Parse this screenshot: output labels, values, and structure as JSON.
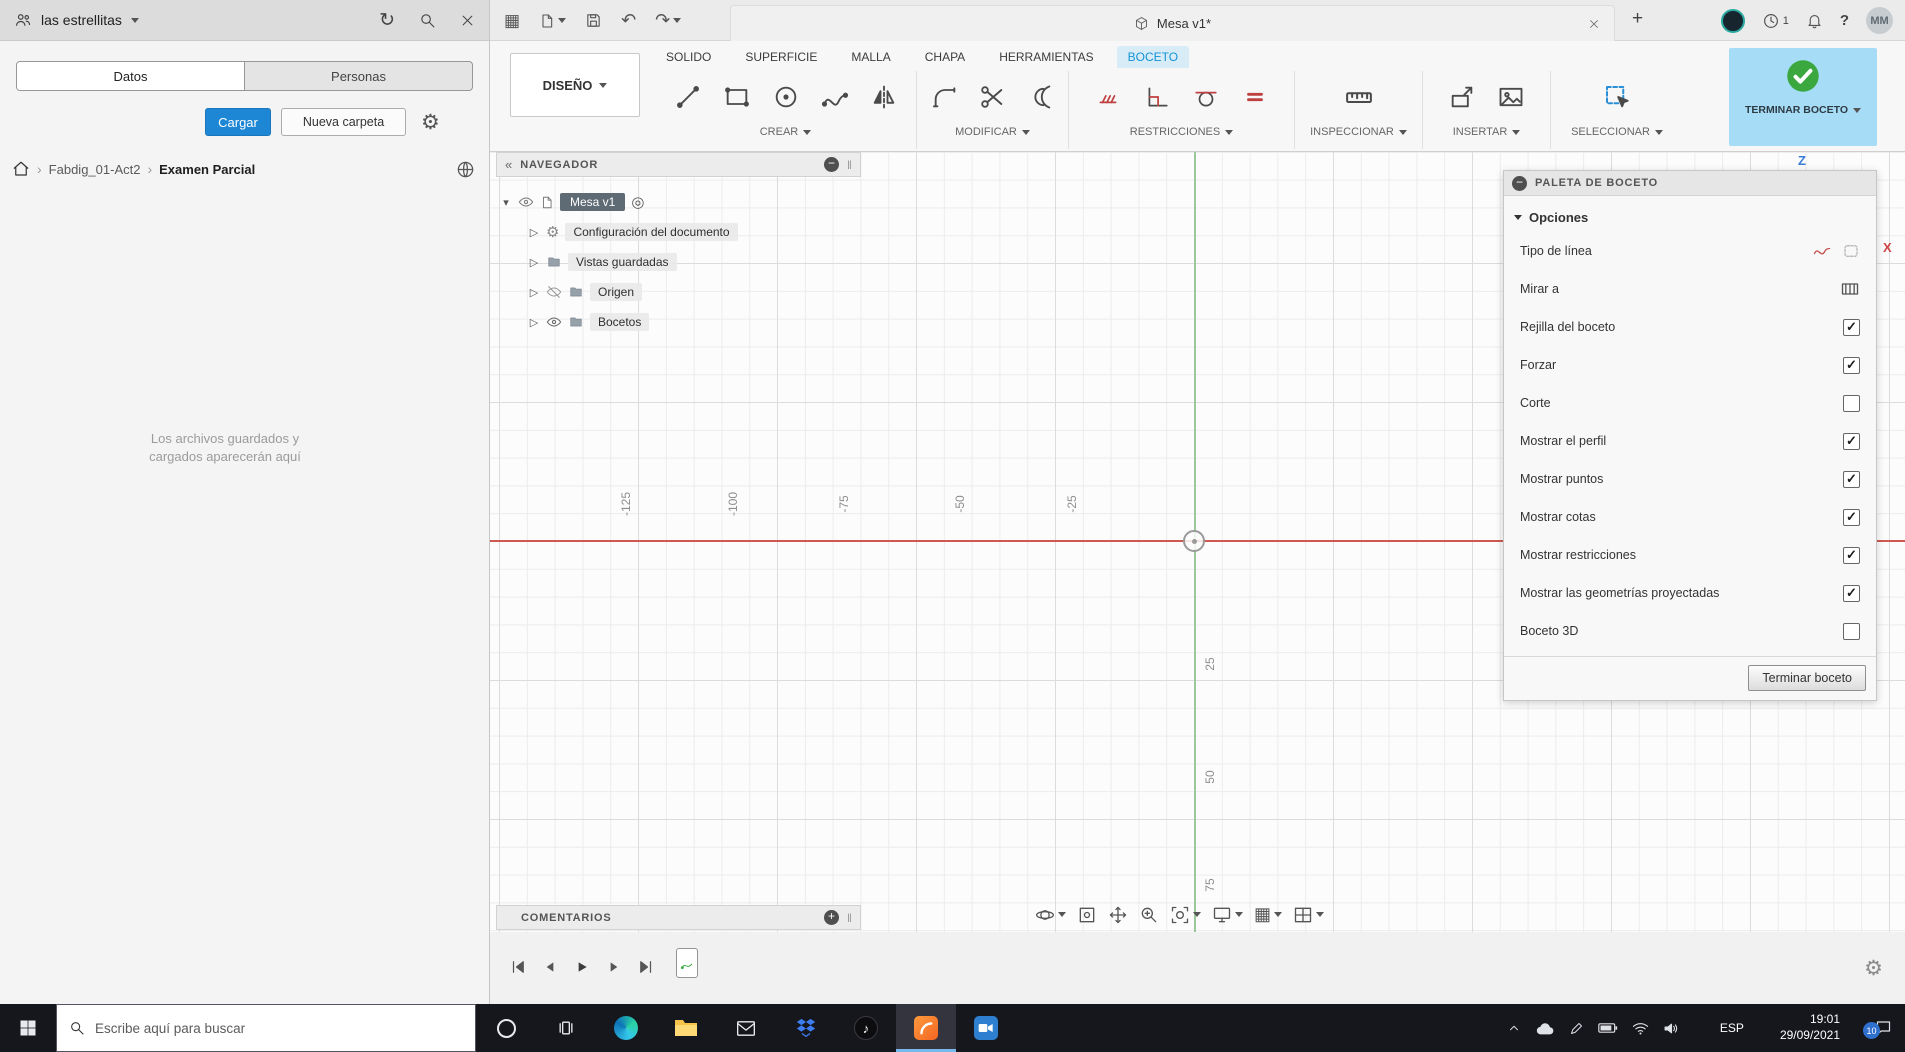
{
  "icons": {
    "gear": "⚙",
    "grid": "▦",
    "undo": "↶",
    "redo": "↷",
    "refresh": "↻",
    "breadcrumb_separator": "›",
    "collapse_left": "«",
    "panel_minus": "−",
    "panel_plus": "+",
    "music_note": "♪",
    "radio_target": "◎",
    "tree_expander": "▷",
    "root_expander": "▾",
    "grip": "‖",
    "new_tab_plus": "+"
  },
  "data_panel": {
    "team_name": "las estrellitas",
    "tab_datos": "Datos",
    "tab_personas": "Personas",
    "upload_button": "Cargar",
    "new_folder_button": "Nueva carpeta",
    "breadcrumb_project": "Fabdig_01-Act2",
    "breadcrumb_folder": "Examen Parcial",
    "empty_line1": "Los archivos guardados y",
    "empty_line2": "cargados aparecerán aquí"
  },
  "app_bar": {
    "document_title": "Mesa v1*",
    "job_count": "1",
    "help_glyph": "?",
    "avatar_initials": "MM"
  },
  "ribbon": {
    "workspace_label": "DISEÑO",
    "tab_solido": "SOLIDO",
    "tab_superficie": "SUPERFICIE",
    "tab_malla": "MALLA",
    "tab_chapa": "CHAPA",
    "tab_herramientas": "HERRAMIENTAS",
    "tab_boceto": "BOCETO",
    "group_crear": "CREAR",
    "group_modificar": "MODIFICAR",
    "group_restricciones": "RESTRICCIONES",
    "group_inspeccionar": "INSPECCIONAR",
    "group_insertar": "INSERTAR",
    "group_seleccionar": "SELECCIONAR",
    "group_terminar": "TERMINAR BOCETO"
  },
  "navigator": {
    "title": "NAVEGADOR",
    "root_label": "Mesa v1",
    "item_config": "Configuración del documento",
    "item_views": "Vistas guardadas",
    "item_origin": "Origen",
    "item_sketches": "Bocetos"
  },
  "canvas": {
    "x_ticks": [
      "-125",
      "-100",
      "-75",
      "-50",
      "-25"
    ],
    "y_ticks": [
      "25",
      "50",
      "75"
    ],
    "z_axis_label": "Z",
    "x_axis_label": "X",
    "x_axis_color": "#cd5a52",
    "y_axis_color": "#9ac89a"
  },
  "sketch_palette": {
    "title": "PALETA DE BOCETO",
    "section_opciones": "Opciones",
    "rows": [
      {
        "label": "Tipo de línea",
        "control": "linetype-icons",
        "glyph": ""
      },
      {
        "label": "Mirar a",
        "control": "look-at-icon",
        "glyph": ""
      },
      {
        "label": "Rejilla del boceto",
        "control": "checkbox",
        "checked": true,
        "glyph": "✓"
      },
      {
        "label": "Forzar",
        "control": "checkbox",
        "checked": true,
        "glyph": "✓"
      },
      {
        "label": "Corte",
        "control": "checkbox",
        "checked": false,
        "glyph": ""
      },
      {
        "label": "Mostrar el perfil",
        "control": "checkbox",
        "checked": true,
        "glyph": "✓"
      },
      {
        "label": "Mostrar puntos",
        "control": "checkbox",
        "checked": true,
        "glyph": "✓"
      },
      {
        "label": "Mostrar cotas",
        "control": "checkbox",
        "checked": true,
        "glyph": "✓"
      },
      {
        "label": "Mostrar restricciones",
        "control": "checkbox",
        "checked": true,
        "glyph": "✓"
      },
      {
        "label": "Mostrar las geometrías proyectadas",
        "control": "checkbox",
        "checked": true,
        "glyph": "✓"
      },
      {
        "label": "Boceto 3D",
        "control": "checkbox",
        "checked": false,
        "glyph": ""
      }
    ],
    "finish_button": "Terminar boceto"
  },
  "comments_panel": {
    "title": "COMENTARIOS"
  },
  "taskbar": {
    "search_placeholder": "Escribe aquí para buscar",
    "language": "ESP",
    "time": "19:01",
    "date": "29/09/2021",
    "notification_badge": "10"
  }
}
